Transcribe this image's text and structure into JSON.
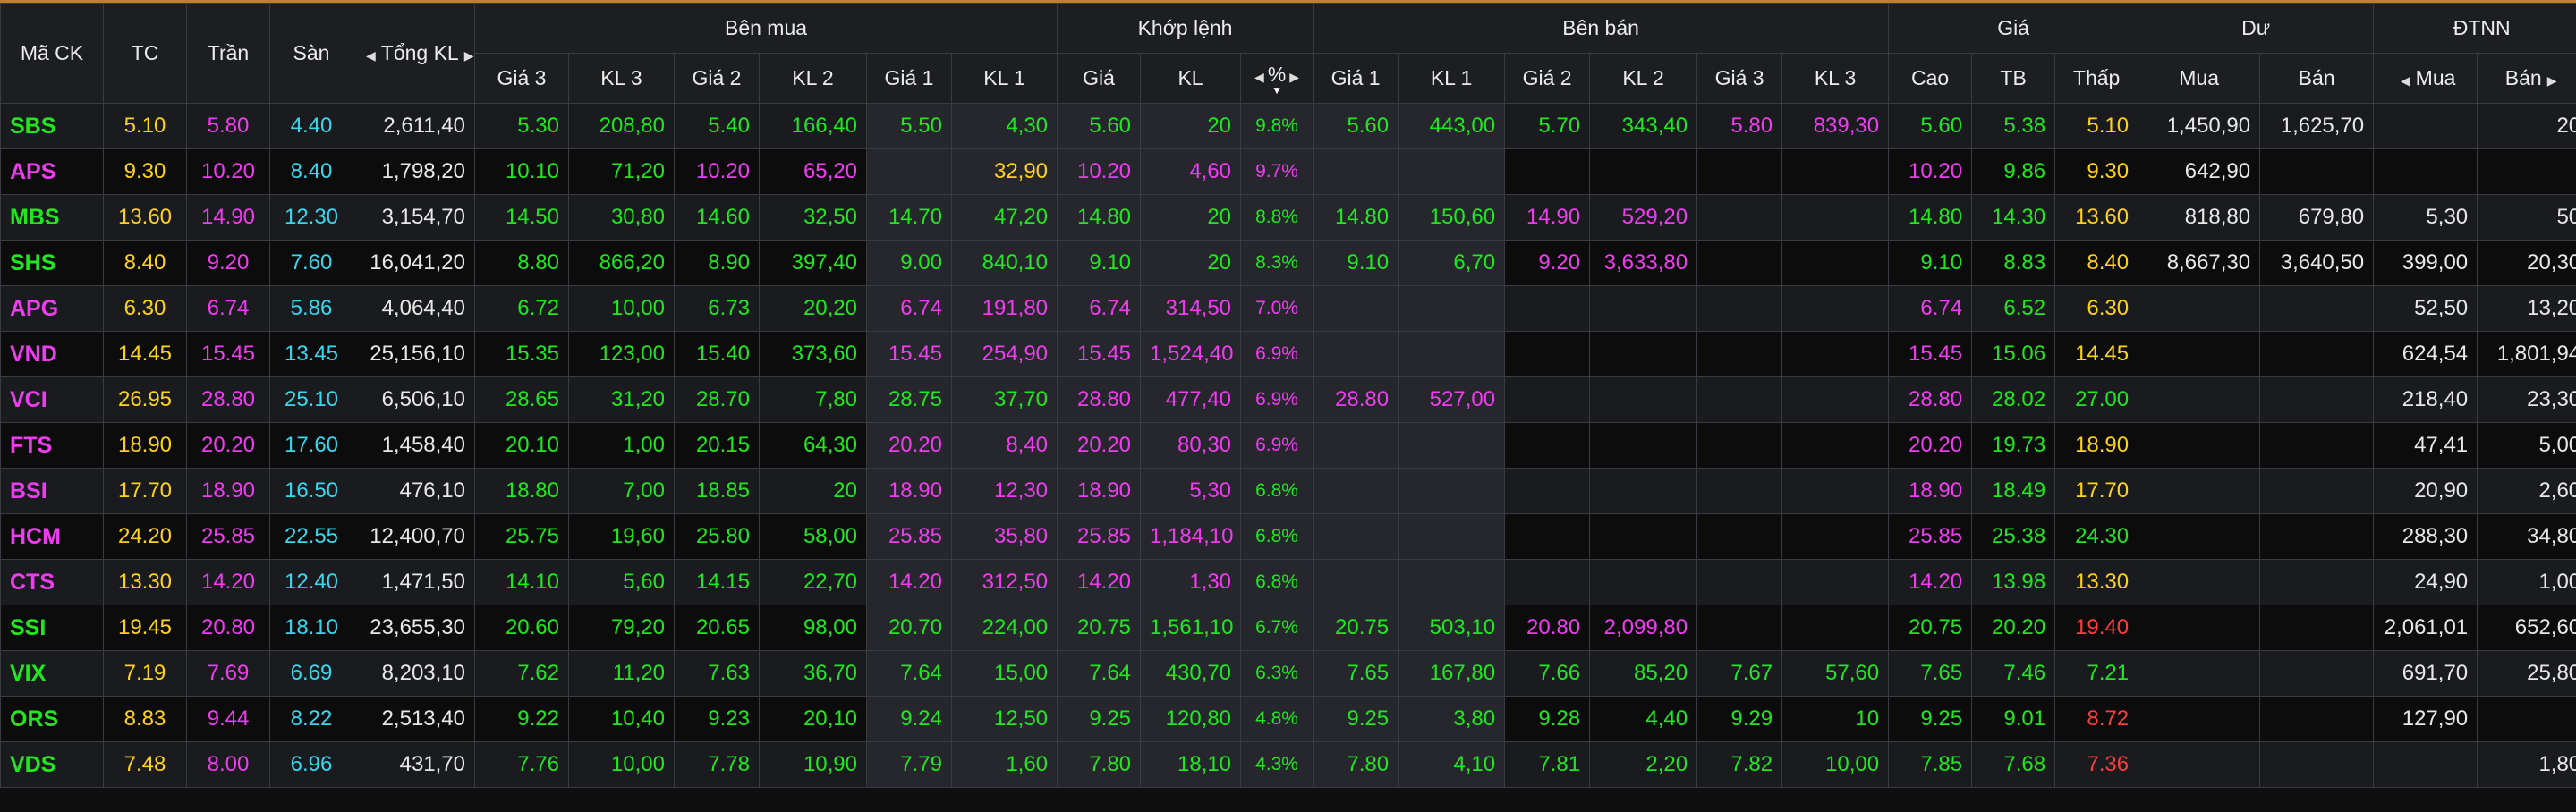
{
  "header": {
    "symbol": "Mã CK",
    "ref": "TC",
    "ceil": "Trần",
    "floor": "Sàn",
    "total_vol": "Tổng KL",
    "buy_group": "Bên mua",
    "match_group": "Khớp lệnh",
    "sell_group": "Bên bán",
    "price_group": "Giá",
    "residual_group": "Dư",
    "foreign_group": "ĐTNN",
    "buy_cols": [
      "Giá 3",
      "KL 3",
      "Giá 2",
      "KL 2",
      "Giá 1",
      "KL 1"
    ],
    "match_cols": [
      "Giá",
      "KL",
      "%"
    ],
    "sell_cols": [
      "Giá 1",
      "KL 1",
      "Giá 2",
      "KL 2",
      "Giá 3",
      "KL 3"
    ],
    "price_cols": [
      "Cao",
      "TB",
      "Thấp"
    ],
    "residual_cols": [
      "Mua",
      "Bán"
    ],
    "foreign_cols": [
      "Mua",
      "Bán"
    ]
  },
  "rows": [
    {
      "sym": "SBS",
      "sc": "g",
      "ref": "5.10",
      "ceil": "5.80",
      "floor": "4.40",
      "total": "2,611,40",
      "b3": [
        "5.30",
        "g"
      ],
      "v3": [
        "208,80",
        "g"
      ],
      "b2": [
        "5.40",
        "g"
      ],
      "v2": [
        "166,40",
        "g"
      ],
      "b1": [
        "5.50",
        "g"
      ],
      "v1": [
        "4,30",
        "g"
      ],
      "mp": [
        "5.60",
        "g"
      ],
      "mv": [
        "20",
        "g"
      ],
      "pct": [
        "9.8%",
        "g"
      ],
      "s1": [
        "5.60",
        "g"
      ],
      "sv1": [
        "443,00",
        "g"
      ],
      "s2": [
        "5.70",
        "g"
      ],
      "sv2": [
        "343,40",
        "g"
      ],
      "s3": [
        "5.80",
        "p"
      ],
      "sv3": [
        "839,30",
        "p"
      ],
      "hi": [
        "5.60",
        "g"
      ],
      "avg": [
        "5.38",
        "g"
      ],
      "lo": [
        "5.10",
        "y"
      ],
      "rb": "1,450,90",
      "rs": "1,625,70",
      "fb": "",
      "fs": "20"
    },
    {
      "sym": "APS",
      "sc": "p",
      "ref": "9.30",
      "ceil": "10.20",
      "floor": "8.40",
      "total": "1,798,20",
      "b3": [
        "10.10",
        "g"
      ],
      "v3": [
        "71,20",
        "g"
      ],
      "b2": [
        "10.20",
        "p"
      ],
      "v2": [
        "65,20",
        "p"
      ],
      "b1": [
        "",
        ""
      ],
      "v1": [
        "32,90",
        "y"
      ],
      "mp": [
        "10.20",
        "p"
      ],
      "mv": [
        "4,60",
        "p"
      ],
      "pct": [
        "9.7%",
        "p"
      ],
      "s1": [
        "",
        ""
      ],
      "sv1": [
        "",
        ""
      ],
      "s2": [
        "",
        ""
      ],
      "sv2": [
        "",
        ""
      ],
      "s3": [
        "",
        ""
      ],
      "sv3": [
        "",
        ""
      ],
      "hi": [
        "10.20",
        "p"
      ],
      "avg": [
        "9.86",
        "g"
      ],
      "lo": [
        "9.30",
        "y"
      ],
      "rb": "642,90",
      "rs": "",
      "fb": "",
      "fs": ""
    },
    {
      "sym": "MBS",
      "sc": "g",
      "ref": "13.60",
      "ceil": "14.90",
      "floor": "12.30",
      "total": "3,154,70",
      "b3": [
        "14.50",
        "g"
      ],
      "v3": [
        "30,80",
        "g"
      ],
      "b2": [
        "14.60",
        "g"
      ],
      "v2": [
        "32,50",
        "g"
      ],
      "b1": [
        "14.70",
        "g"
      ],
      "v1": [
        "47,20",
        "g"
      ],
      "mp": [
        "14.80",
        "g"
      ],
      "mv": [
        "20",
        "g"
      ],
      "pct": [
        "8.8%",
        "g"
      ],
      "s1": [
        "14.80",
        "g"
      ],
      "sv1": [
        "150,60",
        "g"
      ],
      "s2": [
        "14.90",
        "p"
      ],
      "sv2": [
        "529,20",
        "p"
      ],
      "s3": [
        "",
        ""
      ],
      "sv3": [
        "",
        ""
      ],
      "hi": [
        "14.80",
        "g"
      ],
      "avg": [
        "14.30",
        "g"
      ],
      "lo": [
        "13.60",
        "y"
      ],
      "rb": "818,80",
      "rs": "679,80",
      "fb": "5,30",
      "fs": "50"
    },
    {
      "sym": "SHS",
      "sc": "g",
      "ref": "8.40",
      "ceil": "9.20",
      "floor": "7.60",
      "total": "16,041,20",
      "b3": [
        "8.80",
        "g"
      ],
      "v3": [
        "866,20",
        "g"
      ],
      "b2": [
        "8.90",
        "g"
      ],
      "v2": [
        "397,40",
        "g"
      ],
      "b1": [
        "9.00",
        "g"
      ],
      "v1": [
        "840,10",
        "g"
      ],
      "mp": [
        "9.10",
        "g"
      ],
      "mv": [
        "20",
        "g"
      ],
      "pct": [
        "8.3%",
        "g"
      ],
      "s1": [
        "9.10",
        "g"
      ],
      "sv1": [
        "6,70",
        "g"
      ],
      "s2": [
        "9.20",
        "p"
      ],
      "sv2": [
        "3,633,80",
        "p"
      ],
      "s3": [
        "",
        ""
      ],
      "sv3": [
        "",
        ""
      ],
      "hi": [
        "9.10",
        "g"
      ],
      "avg": [
        "8.83",
        "g"
      ],
      "lo": [
        "8.40",
        "y"
      ],
      "rb": "8,667,30",
      "rs": "3,640,50",
      "fb": "399,00",
      "fs": "20,30"
    },
    {
      "sym": "APG",
      "sc": "p",
      "ref": "6.30",
      "ceil": "6.74",
      "floor": "5.86",
      "total": "4,064,40",
      "b3": [
        "6.72",
        "g"
      ],
      "v3": [
        "10,00",
        "g"
      ],
      "b2": [
        "6.73",
        "g"
      ],
      "v2": [
        "20,20",
        "g"
      ],
      "b1": [
        "6.74",
        "p"
      ],
      "v1": [
        "191,80",
        "p"
      ],
      "mp": [
        "6.74",
        "p"
      ],
      "mv": [
        "314,50",
        "p"
      ],
      "pct": [
        "7.0%",
        "p"
      ],
      "s1": [
        "",
        ""
      ],
      "sv1": [
        "",
        ""
      ],
      "s2": [
        "",
        ""
      ],
      "sv2": [
        "",
        ""
      ],
      "s3": [
        "",
        ""
      ],
      "sv3": [
        "",
        ""
      ],
      "hi": [
        "6.74",
        "p"
      ],
      "avg": [
        "6.52",
        "g"
      ],
      "lo": [
        "6.30",
        "y"
      ],
      "rb": "",
      "rs": "",
      "fb": "52,50",
      "fs": "13,20"
    },
    {
      "sym": "VND",
      "sc": "p",
      "ref": "14.45",
      "ceil": "15.45",
      "floor": "13.45",
      "total": "25,156,10",
      "b3": [
        "15.35",
        "g"
      ],
      "v3": [
        "123,00",
        "g"
      ],
      "b2": [
        "15.40",
        "g"
      ],
      "v2": [
        "373,60",
        "g"
      ],
      "b1": [
        "15.45",
        "p"
      ],
      "v1": [
        "254,90",
        "p"
      ],
      "mp": [
        "15.45",
        "p"
      ],
      "mv": [
        "1,524,40",
        "p"
      ],
      "pct": [
        "6.9%",
        "p"
      ],
      "s1": [
        "",
        ""
      ],
      "sv1": [
        "",
        ""
      ],
      "s2": [
        "",
        ""
      ],
      "sv2": [
        "",
        ""
      ],
      "s3": [
        "",
        ""
      ],
      "sv3": [
        "",
        ""
      ],
      "hi": [
        "15.45",
        "p"
      ],
      "avg": [
        "15.06",
        "g"
      ],
      "lo": [
        "14.45",
        "y"
      ],
      "rb": "",
      "rs": "",
      "fb": "624,54",
      "fs": "1,801,94"
    },
    {
      "sym": "VCI",
      "sc": "p",
      "ref": "26.95",
      "ceil": "28.80",
      "floor": "25.10",
      "total": "6,506,10",
      "b3": [
        "28.65",
        "g"
      ],
      "v3": [
        "31,20",
        "g"
      ],
      "b2": [
        "28.70",
        "g"
      ],
      "v2": [
        "7,80",
        "g"
      ],
      "b1": [
        "28.75",
        "g"
      ],
      "v1": [
        "37,70",
        "g"
      ],
      "mp": [
        "28.80",
        "p"
      ],
      "mv": [
        "477,40",
        "p"
      ],
      "pct": [
        "6.9%",
        "p"
      ],
      "s1": [
        "28.80",
        "p"
      ],
      "sv1": [
        "527,00",
        "p"
      ],
      "s2": [
        "",
        ""
      ],
      "sv2": [
        "",
        ""
      ],
      "s3": [
        "",
        ""
      ],
      "sv3": [
        "",
        ""
      ],
      "hi": [
        "28.80",
        "p"
      ],
      "avg": [
        "28.02",
        "g"
      ],
      "lo": [
        "27.00",
        "g"
      ],
      "rb": "",
      "rs": "",
      "fb": "218,40",
      "fs": "23,30"
    },
    {
      "sym": "FTS",
      "sc": "p",
      "ref": "18.90",
      "ceil": "20.20",
      "floor": "17.60",
      "total": "1,458,40",
      "b3": [
        "20.10",
        "g"
      ],
      "v3": [
        "1,00",
        "g"
      ],
      "b2": [
        "20.15",
        "g"
      ],
      "v2": [
        "64,30",
        "g"
      ],
      "b1": [
        "20.20",
        "p"
      ],
      "v1": [
        "8,40",
        "p"
      ],
      "mp": [
        "20.20",
        "p"
      ],
      "mv": [
        "80,30",
        "p"
      ],
      "pct": [
        "6.9%",
        "p"
      ],
      "s1": [
        "",
        ""
      ],
      "sv1": [
        "",
        ""
      ],
      "s2": [
        "",
        ""
      ],
      "sv2": [
        "",
        ""
      ],
      "s3": [
        "",
        ""
      ],
      "sv3": [
        "",
        ""
      ],
      "hi": [
        "20.20",
        "p"
      ],
      "avg": [
        "19.73",
        "g"
      ],
      "lo": [
        "18.90",
        "y"
      ],
      "rb": "",
      "rs": "",
      "fb": "47,41",
      "fs": "5,00"
    },
    {
      "sym": "BSI",
      "sc": "p",
      "ref": "17.70",
      "ceil": "18.90",
      "floor": "16.50",
      "total": "476,10",
      "b3": [
        "18.80",
        "g"
      ],
      "v3": [
        "7,00",
        "g"
      ],
      "b2": [
        "18.85",
        "g"
      ],
      "v2": [
        "20",
        "g"
      ],
      "b1": [
        "18.90",
        "p"
      ],
      "v1": [
        "12,30",
        "p"
      ],
      "mp": [
        "18.90",
        "p"
      ],
      "mv": [
        "5,30",
        "p"
      ],
      "pct": [
        "6.8%",
        "g"
      ],
      "s1": [
        "",
        ""
      ],
      "sv1": [
        "",
        ""
      ],
      "s2": [
        "",
        ""
      ],
      "sv2": [
        "",
        ""
      ],
      "s3": [
        "",
        ""
      ],
      "sv3": [
        "",
        ""
      ],
      "hi": [
        "18.90",
        "p"
      ],
      "avg": [
        "18.49",
        "g"
      ],
      "lo": [
        "17.70",
        "y"
      ],
      "rb": "",
      "rs": "",
      "fb": "20,90",
      "fs": "2,60"
    },
    {
      "sym": "HCM",
      "sc": "p",
      "ref": "24.20",
      "ceil": "25.85",
      "floor": "22.55",
      "total": "12,400,70",
      "b3": [
        "25.75",
        "g"
      ],
      "v3": [
        "19,60",
        "g"
      ],
      "b2": [
        "25.80",
        "g"
      ],
      "v2": [
        "58,00",
        "g"
      ],
      "b1": [
        "25.85",
        "p"
      ],
      "v1": [
        "35,80",
        "p"
      ],
      "mp": [
        "25.85",
        "p"
      ],
      "mv": [
        "1,184,10",
        "p"
      ],
      "pct": [
        "6.8%",
        "g"
      ],
      "s1": [
        "",
        ""
      ],
      "sv1": [
        "",
        ""
      ],
      "s2": [
        "",
        ""
      ],
      "sv2": [
        "",
        ""
      ],
      "s3": [
        "",
        ""
      ],
      "sv3": [
        "",
        ""
      ],
      "hi": [
        "25.85",
        "p"
      ],
      "avg": [
        "25.38",
        "g"
      ],
      "lo": [
        "24.30",
        "g"
      ],
      "rb": "",
      "rs": "",
      "fb": "288,30",
      "fs": "34,80"
    },
    {
      "sym": "CTS",
      "sc": "p",
      "ref": "13.30",
      "ceil": "14.20",
      "floor": "12.40",
      "total": "1,471,50",
      "b3": [
        "14.10",
        "g"
      ],
      "v3": [
        "5,60",
        "g"
      ],
      "b2": [
        "14.15",
        "g"
      ],
      "v2": [
        "22,70",
        "g"
      ],
      "b1": [
        "14.20",
        "p"
      ],
      "v1": [
        "312,50",
        "p"
      ],
      "mp": [
        "14.20",
        "p"
      ],
      "mv": [
        "1,30",
        "p"
      ],
      "pct": [
        "6.8%",
        "g"
      ],
      "s1": [
        "",
        ""
      ],
      "sv1": [
        "",
        ""
      ],
      "s2": [
        "",
        ""
      ],
      "sv2": [
        "",
        ""
      ],
      "s3": [
        "",
        ""
      ],
      "sv3": [
        "",
        ""
      ],
      "hi": [
        "14.20",
        "p"
      ],
      "avg": [
        "13.98",
        "g"
      ],
      "lo": [
        "13.30",
        "y"
      ],
      "rb": "",
      "rs": "",
      "fb": "24,90",
      "fs": "1,00"
    },
    {
      "sym": "SSI",
      "sc": "g",
      "ref": "19.45",
      "ceil": "20.80",
      "floor": "18.10",
      "total": "23,655,30",
      "b3": [
        "20.60",
        "g"
      ],
      "v3": [
        "79,20",
        "g"
      ],
      "b2": [
        "20.65",
        "g"
      ],
      "v2": [
        "98,00",
        "g"
      ],
      "b1": [
        "20.70",
        "g"
      ],
      "v1": [
        "224,00",
        "g"
      ],
      "mp": [
        "20.75",
        "g"
      ],
      "mv": [
        "1,561,10",
        "g"
      ],
      "pct": [
        "6.7%",
        "g"
      ],
      "s1": [
        "20.75",
        "g"
      ],
      "sv1": [
        "503,10",
        "g"
      ],
      "s2": [
        "20.80",
        "p"
      ],
      "sv2": [
        "2,099,80",
        "p"
      ],
      "s3": [
        "",
        ""
      ],
      "sv3": [
        "",
        ""
      ],
      "hi": [
        "20.75",
        "g"
      ],
      "avg": [
        "20.20",
        "g"
      ],
      "lo": [
        "19.40",
        "r"
      ],
      "rb": "",
      "rs": "",
      "fb": "2,061,01",
      "fs": "652,60"
    },
    {
      "sym": "VIX",
      "sc": "g",
      "ref": "7.19",
      "ceil": "7.69",
      "floor": "6.69",
      "total": "8,203,10",
      "b3": [
        "7.62",
        "g"
      ],
      "v3": [
        "11,20",
        "g"
      ],
      "b2": [
        "7.63",
        "g"
      ],
      "v2": [
        "36,70",
        "g"
      ],
      "b1": [
        "7.64",
        "g"
      ],
      "v1": [
        "15,00",
        "g"
      ],
      "mp": [
        "7.64",
        "g"
      ],
      "mv": [
        "430,70",
        "g"
      ],
      "pct": [
        "6.3%",
        "g"
      ],
      "s1": [
        "7.65",
        "g"
      ],
      "sv1": [
        "167,80",
        "g"
      ],
      "s2": [
        "7.66",
        "g"
      ],
      "sv2": [
        "85,20",
        "g"
      ],
      "s3": [
        "7.67",
        "g"
      ],
      "sv3": [
        "57,60",
        "g"
      ],
      "hi": [
        "7.65",
        "g"
      ],
      "avg": [
        "7.46",
        "g"
      ],
      "lo": [
        "7.21",
        "g"
      ],
      "rb": "",
      "rs": "",
      "fb": "691,70",
      "fs": "25,80"
    },
    {
      "sym": "ORS",
      "sc": "g",
      "ref": "8.83",
      "ceil": "9.44",
      "floor": "8.22",
      "total": "2,513,40",
      "b3": [
        "9.22",
        "g"
      ],
      "v3": [
        "10,40",
        "g"
      ],
      "b2": [
        "9.23",
        "g"
      ],
      "v2": [
        "20,10",
        "g"
      ],
      "b1": [
        "9.24",
        "g"
      ],
      "v1": [
        "12,50",
        "g"
      ],
      "mp": [
        "9.25",
        "g"
      ],
      "mv": [
        "120,80",
        "g"
      ],
      "pct": [
        "4.8%",
        "g"
      ],
      "s1": [
        "9.25",
        "g"
      ],
      "sv1": [
        "3,80",
        "g"
      ],
      "s2": [
        "9.28",
        "g"
      ],
      "sv2": [
        "4,40",
        "g"
      ],
      "s3": [
        "9.29",
        "g"
      ],
      "sv3": [
        "10",
        "g"
      ],
      "hi": [
        "9.25",
        "g"
      ],
      "avg": [
        "9.01",
        "g"
      ],
      "lo": [
        "8.72",
        "r"
      ],
      "rb": "",
      "rs": "",
      "fb": "127,90",
      "fs": ""
    },
    {
      "sym": "VDS",
      "sc": "g",
      "ref": "7.48",
      "ceil": "8.00",
      "floor": "6.96",
      "total": "431,70",
      "b3": [
        "7.76",
        "g"
      ],
      "v3": [
        "10,00",
        "g"
      ],
      "b2": [
        "7.78",
        "g"
      ],
      "v2": [
        "10,90",
        "g"
      ],
      "b1": [
        "7.79",
        "g"
      ],
      "v1": [
        "1,60",
        "g"
      ],
      "mp": [
        "7.80",
        "g"
      ],
      "mv": [
        "18,10",
        "g"
      ],
      "pct": [
        "4.3%",
        "g"
      ],
      "s1": [
        "7.80",
        "g"
      ],
      "sv1": [
        "4,10",
        "g"
      ],
      "s2": [
        "7.81",
        "g"
      ],
      "sv2": [
        "2,20",
        "g"
      ],
      "s3": [
        "7.82",
        "g"
      ],
      "sv3": [
        "10,00",
        "g"
      ],
      "hi": [
        "7.85",
        "g"
      ],
      "avg": [
        "7.68",
        "g"
      ],
      "lo": [
        "7.36",
        "r"
      ],
      "rb": "",
      "rs": "",
      "fb": "",
      "fs": "1,80"
    }
  ],
  "colors": {
    "up": "#1fe81f",
    "ceil": "#f03cf0",
    "ref": "#ffd21a",
    "floor": "#38d7ee",
    "down": "#ff3b3b",
    "accent": "#c87d2b"
  },
  "icons": {
    "scroll_left": "triangle-left-icon",
    "scroll_right": "triangle-right-icon",
    "sort_desc": "triangle-down-icon"
  }
}
